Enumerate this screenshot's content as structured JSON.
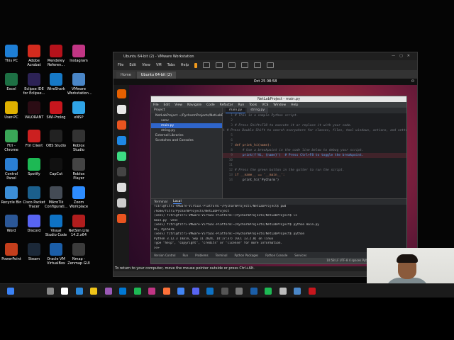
{
  "desktop_icons": [
    {
      "label": "This PC",
      "color": "#1e7fd6"
    },
    {
      "label": "Adobe Acrobat",
      "color": "#d42b1e"
    },
    {
      "label": "Mendeley Referen...",
      "color": "#b5121b"
    },
    {
      "label": "Instagram",
      "color": "#c13584"
    },
    {
      "label": "Excel",
      "color": "#1d7044"
    },
    {
      "label": "Eclipse IDE for Eclipse...",
      "color": "#2c2255"
    },
    {
      "label": "WireShark",
      "color": "#1679c7"
    },
    {
      "label": "VMware Workstation...",
      "color": "#4a86c7"
    },
    {
      "label": "User-PC",
      "color": "#e0b100"
    },
    {
      "label": "VALORANT",
      "color": "#2b0c14"
    },
    {
      "label": "SWI-Prolog",
      "color": "#c7161d"
    },
    {
      "label": "eNSP",
      "color": "#2fa4e7"
    },
    {
      "label": "Ftri - Chrome",
      "color": "#3aa757"
    },
    {
      "label": "Ftri Client",
      "color": "#cc2020"
    },
    {
      "label": "OBS Studio",
      "color": "#222222"
    },
    {
      "label": "Roblox Studio",
      "color": "#333333"
    },
    {
      "label": "Control Panel",
      "color": "#2a7fd4"
    },
    {
      "label": "Spotify",
      "color": "#1db954"
    },
    {
      "label": "CapCut",
      "color": "#111111"
    },
    {
      "label": "Roblox Player",
      "color": "#444444"
    },
    {
      "label": "Recycle Bin",
      "color": "#3c8fd8"
    },
    {
      "label": "Cisco Packet Tracer",
      "color": "#1b5f8c"
    },
    {
      "label": "MikroTik Configurati...",
      "color": "#444b55"
    },
    {
      "label": "Zoom Workplace",
      "color": "#2d8cff"
    },
    {
      "label": "Word",
      "color": "#2b5797"
    },
    {
      "label": "Discord",
      "color": "#5865f2"
    },
    {
      "label": "Visual Studio Code",
      "color": "#0e72c4"
    },
    {
      "label": "NetSim Lite 14.2.x64",
      "color": "#b11d1d"
    },
    {
      "label": "PowerPoint",
      "color": "#c43e1c"
    },
    {
      "label": "Steam",
      "color": "#1b2838"
    },
    {
      "label": "Oracle VM VirtualBox",
      "color": "#1b5ea8"
    },
    {
      "label": "Nmap - Zenmap GUI",
      "color": "#3b3b3b"
    }
  ],
  "vmware": {
    "title": "Ubuntu 64-bit (2) - VMware Workstation",
    "menu": [
      "File",
      "Edit",
      "View",
      "VM",
      "Tabs",
      "Help"
    ],
    "tabs": [
      "Home",
      "Ubuntu 64-bit (2)"
    ],
    "status": "To return to your computer, move the mouse pointer outside or press Ctrl+Alt."
  },
  "ubuntu": {
    "clock": "Oct 25  08:58",
    "dock_colors": [
      "#e66000",
      "#e8e8e8",
      "#e95420",
      "#1e88e5",
      "#3ddc84",
      "#444444",
      "#dddddd",
      "#cccccc",
      "#e95420"
    ]
  },
  "ide": {
    "title": "NetLabProject - main.py",
    "menu": [
      "File",
      "Edit",
      "View",
      "Navigate",
      "Code",
      "Refactor",
      "Run",
      "Tools",
      "VCS",
      "Window",
      "Help"
    ],
    "project_header": "Project",
    "tree": [
      {
        "text": "NetLabProject ~/PycharmProjects/NetLabProject",
        "sel": false
      },
      {
        "text": "venv",
        "sel": false
      },
      {
        "text": "main.py",
        "sel": true
      },
      {
        "text": "string.py",
        "sel": false
      },
      {
        "text": "External Libraries",
        "sel": false
      },
      {
        "text": "Scratches and Consoles",
        "sel": false
      }
    ],
    "editor_tabs": [
      "main.py",
      "string.py"
    ],
    "code": [
      {
        "ln": "1",
        "type": "cm",
        "text": "# This is a sample Python script."
      },
      {
        "ln": "2",
        "type": "",
        "text": ""
      },
      {
        "ln": "3",
        "type": "cm",
        "text": "# Press Shift+F10 to execute it or replace it with your code."
      },
      {
        "ln": "4",
        "type": "cm",
        "text": "# Press Double Shift to search everywhere for classes, files, tool windows, actions, and settings."
      },
      {
        "ln": "5",
        "type": "",
        "text": ""
      },
      {
        "ln": "6",
        "type": "",
        "text": ""
      },
      {
        "ln": "7",
        "type": "def",
        "text": "def print_hi(name):"
      },
      {
        "ln": "8",
        "type": "cm",
        "text": "    # Use a breakpoint in the code line below to debug your script."
      },
      {
        "ln": "9",
        "type": "bp",
        "text": "    print(f'Hi, {name}')  # Press Ctrl+F8 to toggle the breakpoint."
      },
      {
        "ln": "10",
        "type": "",
        "text": ""
      },
      {
        "ln": "11",
        "type": "",
        "text": ""
      },
      {
        "ln": "12",
        "type": "cm",
        "text": "# Press the green button in the gutter to run the script."
      },
      {
        "ln": "13",
        "type": "kw",
        "text": "if __name__ == '__main__':"
      },
      {
        "ln": "14",
        "type": "",
        "text": "    print_hi('PyCharm')"
      }
    ],
    "terminal_tabs": [
      "Terminal",
      "Local"
    ],
    "terminal_lines": [
      "fitri@fitri-VMware-Virtual-Platform:~/PycharmProjects/NetLabProject$ pwd",
      "/home/fitri/PycharmProjects/NetLabProject",
      "(venv) fitri@fitri-VMware-Virtual-Platform:~/PycharmProjects/NetLabProject$ ls",
      "main.py  venv",
      "(venv) fitri@fitri-VMware-Virtual-Platform:~/PycharmProjects/NetLabProject$ python main.py",
      "Hi, PyCharm",
      "(venv) fitri@fitri-VMware-Virtual-Platform:~/PycharmProjects/NetLabProject$ python",
      "Python 3.12.3 (main, Sep 11 2024, 14:17:37) [GCC 13.2.0] on linux",
      "Type \"help\", \"copyright\", \"credits\" or \"license\" for more information.",
      ">>> "
    ],
    "bottom_tools": [
      "Version Control",
      "Run",
      "Problems",
      "Terminal",
      "Python Packages",
      "Python Console",
      "Services"
    ],
    "status": "10:58   LF   UTF-8   4 spaces   Python 3.12 (NetLabProject)"
  },
  "taskbar_colors": [
    "#3b82f6",
    "#888888",
    "#ffffff",
    "#2b88d8",
    "#f0c419",
    "#9b59b6",
    "#0078d4",
    "#1db954",
    "#c13584",
    "#ff7139",
    "#4285f4",
    "#5865f2",
    "#0e72c4",
    "#555555",
    "#777777",
    "#1b5ea8",
    "#1db954",
    "#bbbbbb",
    "#4a86c7",
    "#c7161d"
  ]
}
